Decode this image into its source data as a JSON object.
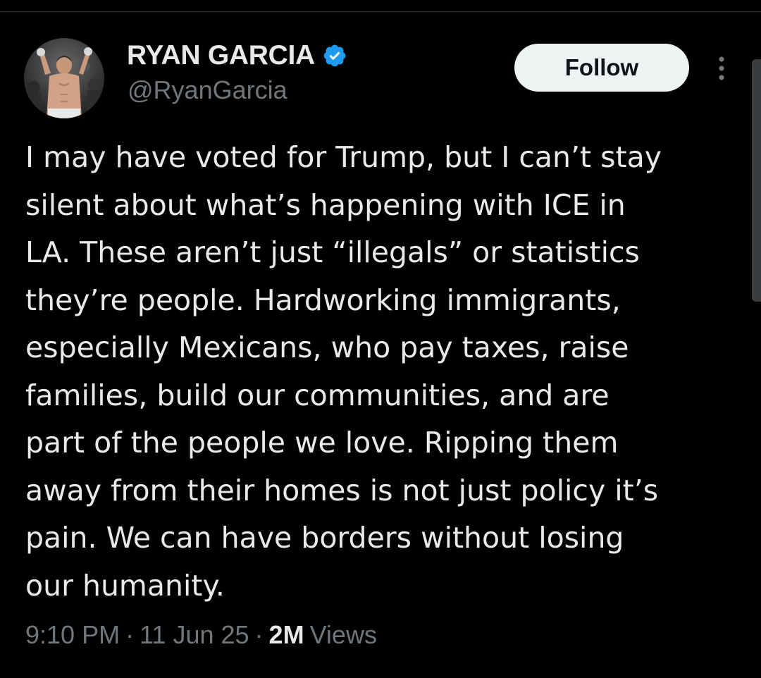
{
  "tweet": {
    "author": {
      "display_name": "RYAN GARCIA",
      "handle": "@RyanGarcia",
      "verified_icon": "verified-badge-icon",
      "avatar_icon": "profile-photo"
    },
    "follow_label": "Follow",
    "more_icon": "more-vertical-icon",
    "text_lines": [
      "I may have voted for Trump, but I can’t stay",
      "silent about what’s happening with ICE in",
      "LA. These aren’t just “illegals” or statistics",
      "they’re people. Hardworking immigrants,",
      "especially Mexicans, who pay taxes, raise",
      "families, build our communities, and are",
      "part of the people we love. Ripping them",
      "away from their homes is not just policy it’s",
      "pain. We can have borders without losing",
      "our humanity."
    ],
    "meta": {
      "time": "9:10 PM",
      "separator": "·",
      "date": "11 Jun 25",
      "views_count": "2M",
      "views_label": "Views"
    }
  },
  "colors": {
    "background": "#000000",
    "text_primary": "#e7e9ea",
    "text_secondary": "#71767b",
    "verified_blue": "#1d9bf0",
    "follow_bg": "#eff3f4",
    "follow_text": "#0f1419"
  }
}
